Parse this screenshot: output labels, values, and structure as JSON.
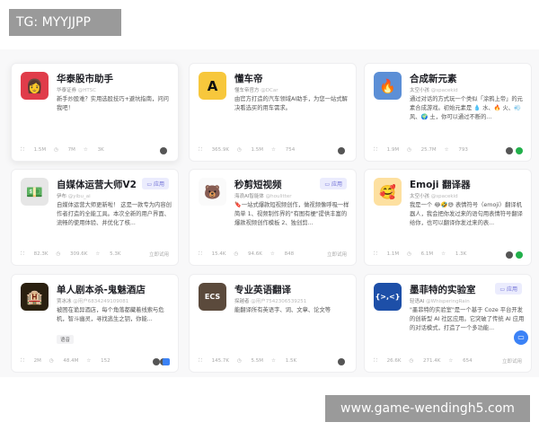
{
  "watermark": "TG: MYYJJPP",
  "site": "www.game-wendingh5.com",
  "cards": [
    {
      "title": "华泰股市助手",
      "author": "华泰证券",
      "handle": "@HTSC",
      "desc": "新手炒股难？实用选股技巧+避坑指南，问问我吧！",
      "users": "1.5M",
      "runs": "7M",
      "stars": "3K",
      "avatar": "👩",
      "avatar_bg": "#e03c4a"
    },
    {
      "title": "懂车帝",
      "author": "懂车帝官方",
      "handle": "@DCar",
      "desc": "由官方打造的汽车领域AI助手，为您一站式解决看选买的用车需求。",
      "users": "365.9K",
      "runs": "1.5M",
      "stars": "754",
      "avatar": "A",
      "avatar_bg": "#f7c73c"
    },
    {
      "title": "合成新元素",
      "author": "太空小孩",
      "handle": "@spacekid",
      "desc": "通过对话的方式玩一个类似「涂鸦上帝」的元素合成游戏。初始元素是 💧 水、🔥 火、💨 风、🌍 土，你可以通过不断的...",
      "users": "1.9M",
      "runs": "25.7M",
      "stars": "793",
      "avatar": "🔥",
      "avatar_bg": "#5c8fd6"
    },
    {
      "title": "自媒体运营大师V2",
      "author": "伊布",
      "handle": "@yibu_ai",
      "desc": "自媒体运营大师更新啦！ 这是一款专为内容创作者打造的全能工具。本次全新的用户界面、流畅的使用体验、并优化了核...",
      "users": "82.3K",
      "runs": "309.6K",
      "stars": "5.3K",
      "tag": "应用",
      "try": "立即试用",
      "avatar": "💵",
      "avatar_bg": "#e6e6e6"
    },
    {
      "title": "秒剪短视频",
      "author": "海浪AI智能体",
      "handle": "@houlitter",
      "desc": "🔖一站式爆款短视频创作，做视频像呼吸一样简单 1、视频制作界的\"有图有梗\"提供丰富的爆款视频创作模板 2、独创剪...",
      "users": "15.4K",
      "runs": "94.6K",
      "stars": "848",
      "tag": "应用",
      "try": "立即试用",
      "avatar": "🐻",
      "avatar_bg": "#fafafa"
    },
    {
      "title": "Emoji 翻译器",
      "author": "太空小孩",
      "handle": "@spacekid",
      "desc": "我是一个 😂🤣😅 表情符号（emoji）翻译机器人，我会把你发过来的语句用表情符号翻译给你，也可以翻译你发过来的表...",
      "users": "1.1M",
      "runs": "6.1M",
      "stars": "1.3K",
      "avatar": "🥰",
      "avatar_bg": "#fde0a0"
    },
    {
      "title": "单人剧本杀-鬼魅酒店",
      "author": "贾冰冰",
      "handle": "@用户6834249109081",
      "desc": "被困在诡异酒店，每个角落都藏着线索与危机，智斗幽灵，寻找逃生之钥，你能...",
      "chip": "语音",
      "users": "2M",
      "runs": "48.4M",
      "stars": "152",
      "avatar": "🏨",
      "avatar_bg": "#2a2010"
    },
    {
      "title": "专业英语翻译",
      "author": "探越者",
      "handle": "@用户7542306539251",
      "desc": "能翻译所有英语字、词、文章、论文等",
      "users": "145.7K",
      "runs": "5.5M",
      "stars": "1.5K",
      "avatar": "ECS",
      "avatar_bg": "#5b4a3c"
    },
    {
      "title": "墨菲特的实验室",
      "author": "轻语AI",
      "handle": "@WhisperingRain",
      "desc": "\"墨菲特的实验室\"是一个基于 Coze 平台开发的创新型 AI 社区应用。它突破了传统 AI 应用的对话模式，打造了一个多功能...",
      "users": "26.6K",
      "runs": "271.4K",
      "stars": "654",
      "tag": "应用",
      "try": "立即试用",
      "avatar": "{>,<}",
      "avatar_bg": "#1d4fa8"
    }
  ],
  "icons": {
    "users": "users-icon",
    "runs": "clock-icon",
    "stars": "star-icon"
  }
}
